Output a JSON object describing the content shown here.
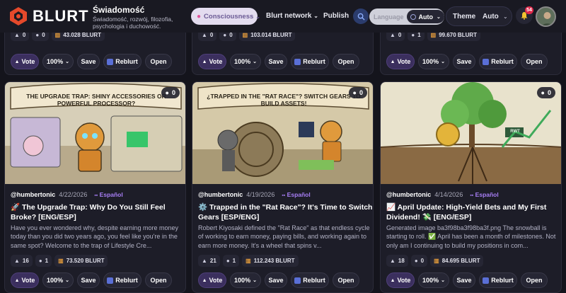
{
  "header": {
    "brand": "BLURT",
    "community_title": "Świadomość",
    "community_desc": "Świadomość, rozwój, filozofia, psychologia i duchowość.",
    "community_pill": "Consciousness",
    "nav_network": "Blurt network",
    "nav_publish": "Publish",
    "language_label": "Language",
    "language_value": "Auto",
    "theme_label": "Theme",
    "theme_value": "Auto",
    "notifications": "54"
  },
  "top_row": [
    {
      "upvotes": "0",
      "comments": "0",
      "payout": "43.028 BLURT"
    },
    {
      "upvotes": "0",
      "comments": "0",
      "payout": "103.014 BLURT"
    },
    {
      "upvotes": "0",
      "comments": "1",
      "payout": "99.670 BLURT"
    }
  ],
  "actions": {
    "vote": "Vote",
    "percent": "100%",
    "save": "Save",
    "reblurt": "Reblurt",
    "open": "Open"
  },
  "posts": [
    {
      "comment_count": "0",
      "author": "@humbertonic",
      "date": "4/22/2026",
      "language": "Español",
      "title": "🚀 The Upgrade Trap: Why Do You Still Feel Broke? [ENG/ESP]",
      "excerpt": "Have you ever wondered why, despite earning more money today than you did two years ago, you feel like you're in the same spot? Welcome to the trap of Lifestyle Cre...",
      "upvotes": "16",
      "comments": "1",
      "payout": "73.520 BLURT",
      "image_text": "THE UPGRADE TRAP: SHINY ACCESSORIES OR POWERFUL PROCESSOR?"
    },
    {
      "comment_count": "0",
      "author": "@humbertonic",
      "date": "4/19/2026",
      "language": "Español",
      "title": "⚙️ Trapped in the \"Rat Race\"? It's Time to Switch Gears [ESP/ENG]",
      "excerpt": "Robert Kiyosaki defined the \"Rat Race\" as that endless cycle of working to earn money, paying bills, and working again to earn more money. It's a wheel that spins v...",
      "upvotes": "21",
      "comments": "1",
      "payout": "112.243 BLURT",
      "image_text": "¿TRAPPED IN THE \"RAT RACE\"? SWITCH GEARS TO BUILD ASSETS!"
    },
    {
      "comment_count": "0",
      "author": "@humbertonic",
      "date": "4/14/2026",
      "language": "Español",
      "title": "📈 April Update: High-Yield Bets and My First Dividend! 💸 [ENG/ESP]",
      "excerpt": "Generated image ba3f98ba3f98ba3f.png The snowball is starting to roll. ✅ April has been a month of milestones. Not only am I continuing to build my positions in com...",
      "upvotes": "18",
      "comments": "0",
      "payout": "84.695 BLURT",
      "image_text": "RWT"
    }
  ]
}
